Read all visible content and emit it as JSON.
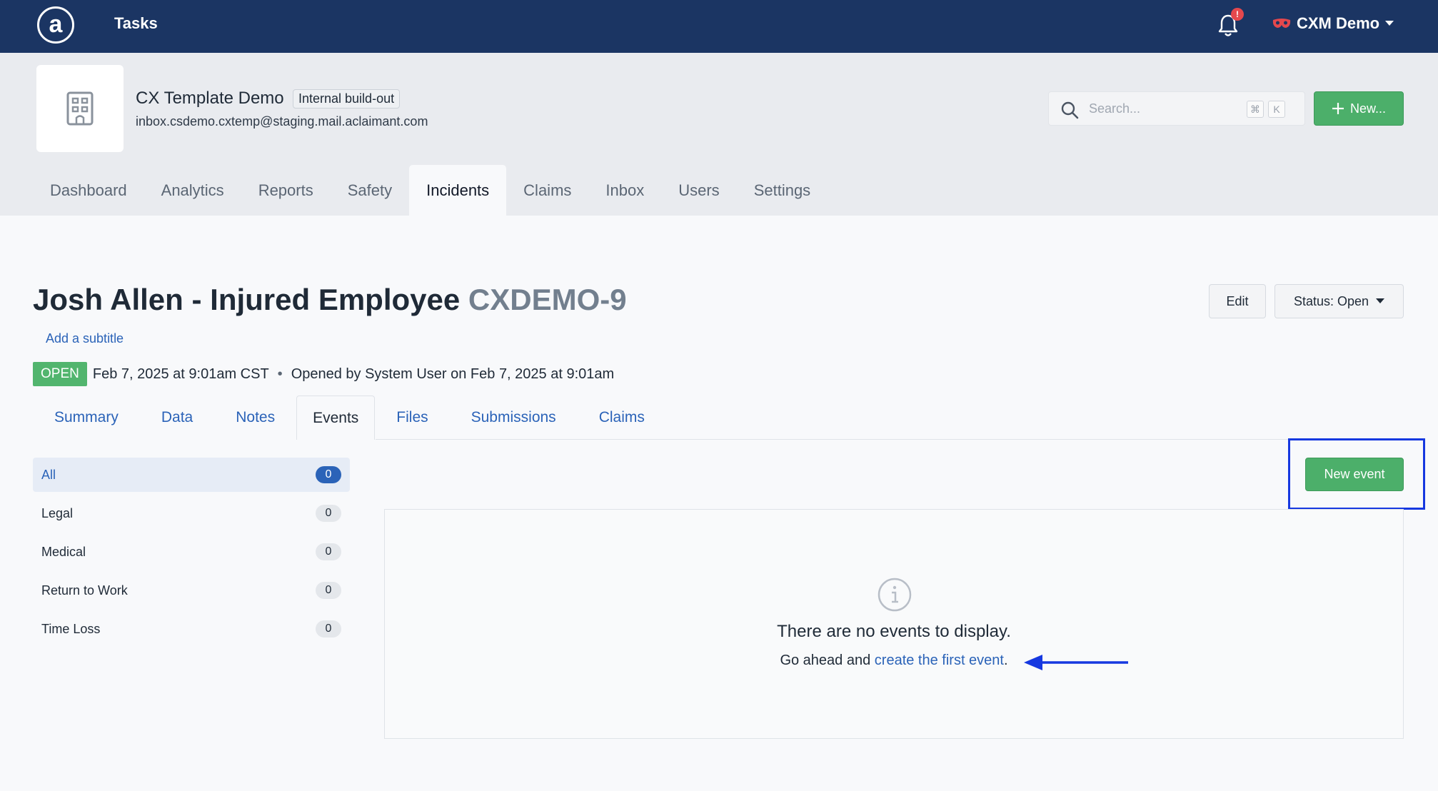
{
  "topbar": {
    "logo_text": "a",
    "tasks_label": "Tasks",
    "notification_badge": "!",
    "user_name": "CXM Demo"
  },
  "org": {
    "name": "CX Template Demo",
    "tag": "Internal build-out",
    "email": "inbox.csdemo.cxtemp@staging.mail.aclaimant.com"
  },
  "search": {
    "placeholder": "Search...",
    "shortcut_key1": "⌘",
    "shortcut_key2": "K"
  },
  "new_button_label": "New...",
  "main_tabs": [
    "Dashboard",
    "Analytics",
    "Reports",
    "Safety",
    "Incidents",
    "Claims",
    "Inbox",
    "Users",
    "Settings"
  ],
  "active_main_tab": "Incidents",
  "incident": {
    "title": "Josh Allen - Injured Employee",
    "code": "CXDEMO-9",
    "edit_label": "Edit",
    "status_label": "Status: Open",
    "subtitle_link": "Add a subtitle",
    "badge": "OPEN",
    "date": "Feb 7, 2025 at 9:01am CST",
    "separator": "•",
    "opened_by": "Opened by System User on Feb 7, 2025 at 9:01am"
  },
  "sub_tabs": [
    "Summary",
    "Data",
    "Notes",
    "Events",
    "Files",
    "Submissions",
    "Claims"
  ],
  "active_sub_tab": "Events",
  "filters": [
    {
      "label": "All",
      "count": "0"
    },
    {
      "label": "Legal",
      "count": "0"
    },
    {
      "label": "Medical",
      "count": "0"
    },
    {
      "label": "Return to Work",
      "count": "0"
    },
    {
      "label": "Time Loss",
      "count": "0"
    }
  ],
  "new_event_label": "New event",
  "empty_state": {
    "title": "There are no events to display.",
    "prefix": "Go ahead and ",
    "link": "create the first event",
    "suffix": "."
  },
  "colors": {
    "nav_bg": "#1b3563",
    "accent_blue": "#2b63b8",
    "success_green": "#4caf6a",
    "annotation_blue": "#1638e0"
  }
}
